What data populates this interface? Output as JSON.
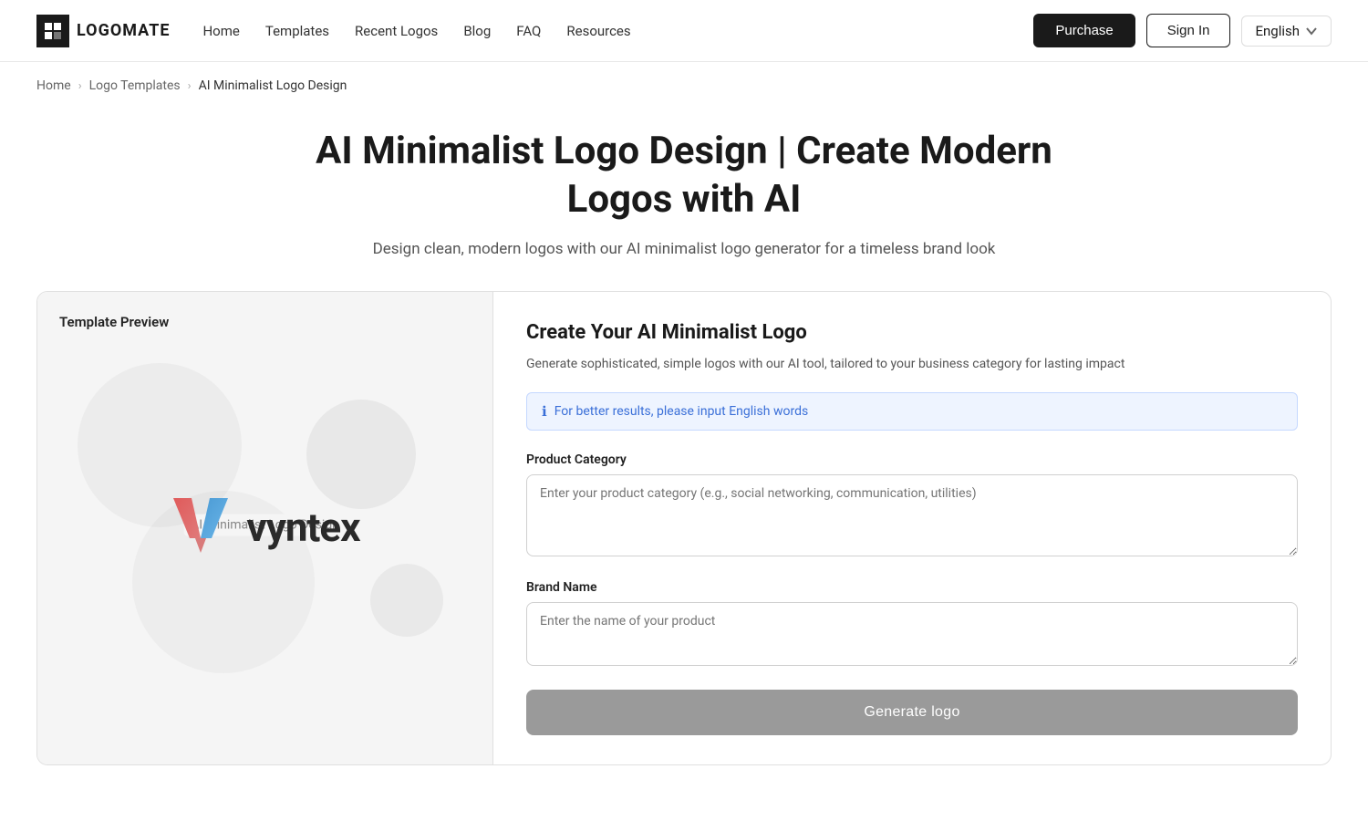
{
  "nav": {
    "logo_text": "LOGOMATE",
    "links": [
      {
        "label": "Home",
        "key": "home"
      },
      {
        "label": "Templates",
        "key": "templates"
      },
      {
        "label": "Recent Logos",
        "key": "recent-logos"
      },
      {
        "label": "Blog",
        "key": "blog"
      },
      {
        "label": "FAQ",
        "key": "faq"
      },
      {
        "label": "Resources",
        "key": "resources"
      }
    ],
    "purchase_label": "Purchase",
    "signin_label": "Sign In",
    "language": "English"
  },
  "breadcrumb": {
    "home": "Home",
    "logo_templates": "Logo Templates",
    "current": "AI Minimalist Logo Design"
  },
  "hero": {
    "title": "AI Minimalist Logo Design | Create Modern Logos with AI",
    "subtitle": "Design clean, modern logos with our AI minimalist logo generator for a timeless brand look"
  },
  "preview": {
    "title": "Template Preview",
    "label": "AI Minimalist Logo Design",
    "logo_brand": "vyntex"
  },
  "form": {
    "title": "Create Your AI Minimalist Logo",
    "subtitle": "Generate sophisticated, simple logos with our AI tool, tailored to your business category for lasting impact",
    "info_banner": "For better results, please input English words",
    "product_category_label": "Product Category",
    "product_category_placeholder": "Enter your product category (e.g., social networking, communication, utilities)",
    "brand_name_label": "Brand Name",
    "brand_name_placeholder": "Enter the name of your product",
    "generate_button": "Generate logo"
  }
}
